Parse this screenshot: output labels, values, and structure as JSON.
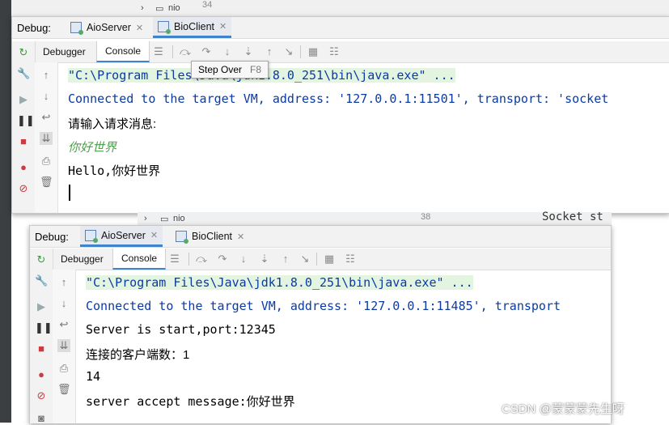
{
  "background": {
    "breadcrumb_top": "nio",
    "line_number_top": "34",
    "breadcrumb_mid": "nio",
    "line_number_mid": "38",
    "code_fragment": "Socket st"
  },
  "win1": {
    "debug_label": "Debug:",
    "tabs": [
      {
        "label": "AioServer"
      },
      {
        "label": "BioClient"
      }
    ],
    "active_tab": "BioClient",
    "subtabs": {
      "debugger": "Debugger",
      "console": "Console"
    },
    "tooltip": {
      "label": "Step Over",
      "shortcut": "F8"
    },
    "console_lines": [
      "\"C:\\Program Files\\Java\\jdk1.8.0_251\\bin\\java.exe\" ...",
      "Connected to the target VM, address: '127.0.0.1:11501', transport: 'socket",
      "请输入请求消息:",
      "你好世界",
      "Hello,你好世界"
    ]
  },
  "win2": {
    "debug_label": "Debug:",
    "tabs": [
      {
        "label": "AioServer"
      },
      {
        "label": "BioClient"
      }
    ],
    "active_tab": "AioServer",
    "subtabs": {
      "debugger": "Debugger",
      "console": "Console"
    },
    "console_lines": [
      "\"C:\\Program Files\\Java\\jdk1.8.0_251\\bin\\java.exe\" ...",
      "Connected to the target VM, address: '127.0.0.1:11485', transport",
      "Server is start,port:12345",
      "连接的客户端数：1",
      "14",
      "server accept message:你好世界"
    ]
  },
  "watermark": "CSDN @蒙蒙蒙先生呀",
  "colors": {
    "accent": "#4083c9",
    "console_blue": "#0a3aa4",
    "input_green": "#4aa24a",
    "cmd_bg": "#e3f5e1"
  }
}
